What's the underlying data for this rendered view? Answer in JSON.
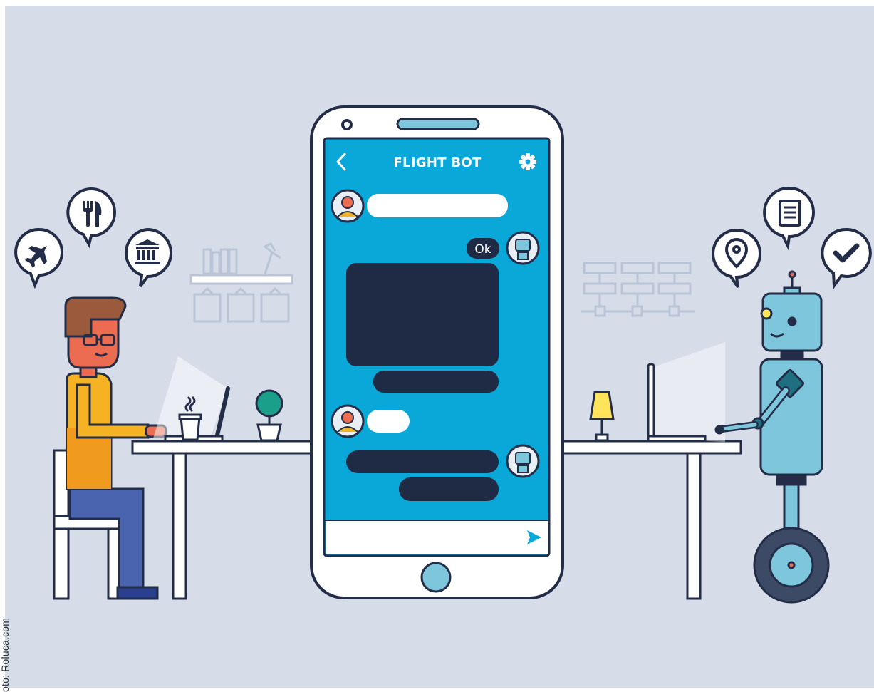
{
  "photo_credit": "oto: Roluca.com",
  "phone": {
    "app_title": "FLIGHT BOT",
    "quick_reply": "Ok",
    "icons": {
      "back": "chevron-left-icon",
      "settings": "gear-icon",
      "send": "send-icon",
      "home": "home-button"
    }
  },
  "bubbles_left": [
    "airplane-icon",
    "fork-knife-icon",
    "museum-icon"
  ],
  "bubbles_right": [
    "map-pin-icon",
    "document-icon",
    "checkmark-icon"
  ],
  "colors": {
    "background": "#d6dde8",
    "screen": "#0aa8d8",
    "dark_bubble": "#1f2a44",
    "outline": "#232d48",
    "robot": "#7ec6dc",
    "shirt": "#f5b324",
    "pants": "#4a64b0",
    "skin": "#ec6c52"
  }
}
